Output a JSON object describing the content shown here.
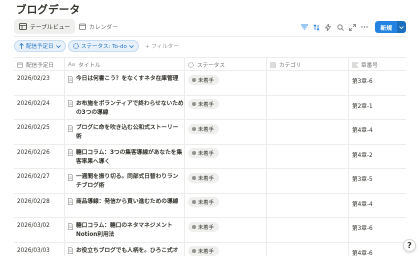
{
  "page": {
    "title": "ブログデータ"
  },
  "views": [
    {
      "label": "テーブルビュー",
      "icon": "table-icon",
      "active": true
    },
    {
      "label": "カレンダー",
      "icon": "calendar-icon",
      "active": false
    }
  ],
  "toolbar": {
    "new_label": "新規"
  },
  "filters": {
    "sort_chip": "配信予定日",
    "status_chip": "ステータス: To-do",
    "add_filter": "+ フィルター"
  },
  "columns": [
    {
      "label": "配信予定日",
      "icon": "calendar-icon"
    },
    {
      "label": "タイトル",
      "icon": "text-aa-icon",
      "prefix": "Aa"
    },
    {
      "label": "ステータス",
      "icon": "status-icon"
    },
    {
      "label": "カテゴリ",
      "icon": "list-icon"
    },
    {
      "label": "章番号",
      "icon": "lines-icon"
    }
  ],
  "rows": [
    {
      "date": "2026/02/23",
      "title": "今日は何書こう？をなくすネタ在庫管理",
      "status": "未着手",
      "category": "",
      "chapter": "第3章-6"
    },
    {
      "date": "2026/02/24",
      "title": "お布施をボランティアで終わらせないための3つの導線",
      "status": "未着手",
      "category": "",
      "chapter": "第2章-1"
    },
    {
      "date": "2026/02/25",
      "title": "ブログに命を吹き込む公和式ストーリー術",
      "status": "未着手",
      "category": "",
      "chapter": "第4章-4"
    },
    {
      "date": "2026/02/26",
      "title": "糖口コラム：3つの集客導線があなたを集客率果へ導く",
      "status": "未着手",
      "category": "",
      "chapter": "第4章-2"
    },
    {
      "date": "2026/02/27",
      "title": "一週間を振り切る。同部式日替わりランチブログ術",
      "status": "未着手",
      "category": "",
      "chapter": "第3章-5"
    },
    {
      "date": "2026/02/28",
      "title": "商品導線：発信から買い進むための導線",
      "status": "未着手",
      "category": "",
      "chapter": "第4章-4"
    },
    {
      "date": "2026/03/02",
      "title": "糖口コラム：糖口のネタマネジメントNotion利用法",
      "status": "未着手",
      "category": "",
      "chapter": "第3章-6"
    },
    {
      "date": "2026/03/03",
      "title": "お役立ちブログでも人柄を。ひろこ式オープニングトーク",
      "status": "未着手",
      "category": "",
      "chapter": "第4章-6"
    }
  ],
  "fab": {
    "label": "?"
  },
  "colors": {
    "accent": "#2383e2",
    "chip_bg": "#e7f0fb",
    "badge_bg": "#efefed"
  }
}
